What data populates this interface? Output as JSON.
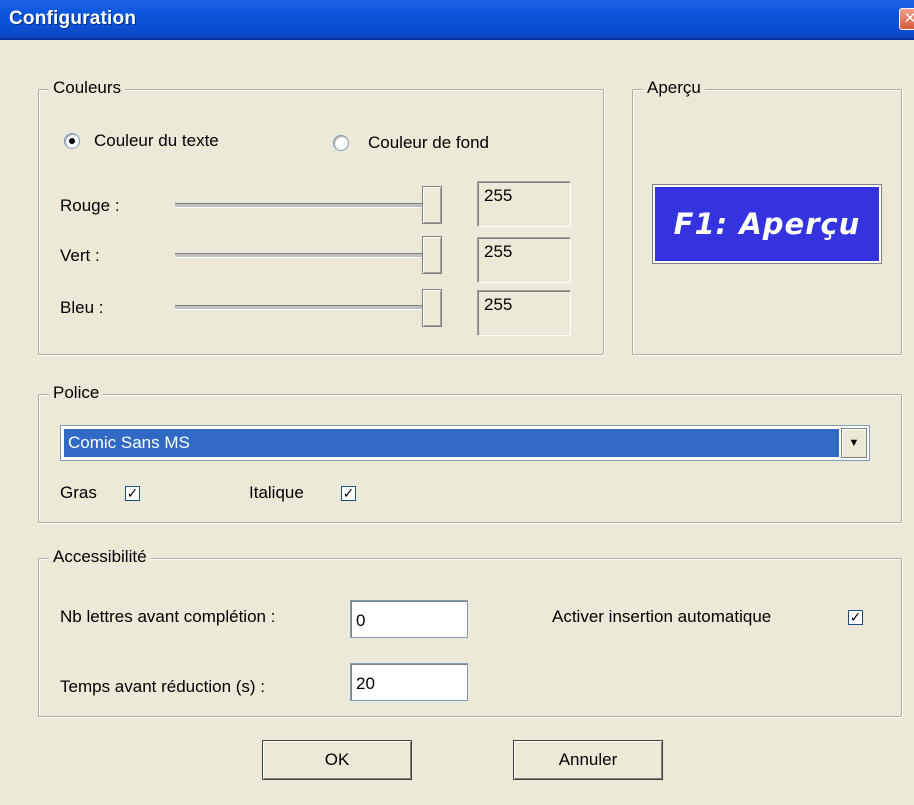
{
  "window": {
    "title": "Configuration",
    "close_glyph": "✕"
  },
  "colors": {
    "group_label": "Couleurs",
    "radio_text_label": "Couleur du texte",
    "radio_background_label": "Couleur de fond",
    "selected": "text",
    "sliders": [
      {
        "label": "Rouge :",
        "value": "255",
        "level": 1.0
      },
      {
        "label": "Vert :",
        "value": "255",
        "level": 1.0
      },
      {
        "label": "Bleu :",
        "value": "255",
        "level": 1.0
      }
    ]
  },
  "preview": {
    "group_label": "Aperçu",
    "text": "F1: Aperçu",
    "background_color": "#3333e0",
    "text_color": "#ffffff"
  },
  "font": {
    "group_label": "Police",
    "selected_font": "Comic Sans MS",
    "bold_label": "Gras",
    "bold_checked": true,
    "italic_label": "Italique",
    "italic_checked": true
  },
  "accessibility": {
    "group_label": "Accessibilité",
    "letters_label": "Nb lettres avant complétion :",
    "letters_value": "0",
    "time_label": "Temps avant réduction (s) :",
    "time_value": "20",
    "auto_insert_label": "Activer insertion automatique",
    "auto_insert_checked": true
  },
  "buttons": {
    "ok_label": "OK",
    "cancel_label": "Annuler"
  },
  "theme": {
    "titlebar_color": "#0a56e0",
    "selection_color": "#316ac5",
    "dialog_bg": "#ece9d8"
  }
}
